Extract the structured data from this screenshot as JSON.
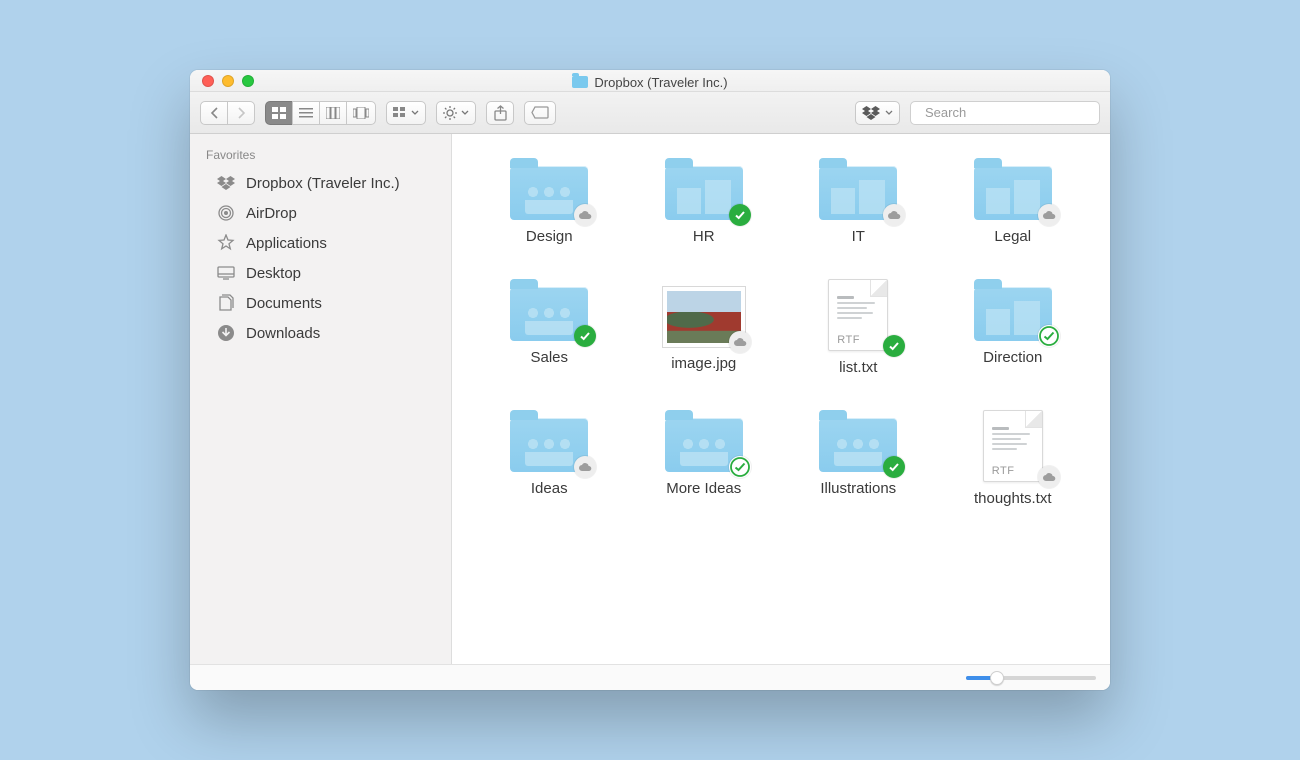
{
  "window": {
    "title": "Dropbox (Traveler Inc.)"
  },
  "search": {
    "placeholder": "Search"
  },
  "sidebar": {
    "header": "Favorites",
    "items": [
      {
        "label": "Dropbox (Traveler Inc.)",
        "icon": "dropbox"
      },
      {
        "label": "AirDrop",
        "icon": "airdrop"
      },
      {
        "label": "Applications",
        "icon": "apps"
      },
      {
        "label": "Desktop",
        "icon": "desktop"
      },
      {
        "label": "Documents",
        "icon": "documents"
      },
      {
        "label": "Downloads",
        "icon": "downloads"
      }
    ]
  },
  "items": [
    {
      "name": "Design",
      "type": "folder",
      "variant": "people",
      "badge": "cloud"
    },
    {
      "name": "HR",
      "type": "folder",
      "variant": "building",
      "badge": "sync"
    },
    {
      "name": "IT",
      "type": "folder",
      "variant": "building",
      "badge": "cloud"
    },
    {
      "name": "Legal",
      "type": "folder",
      "variant": "building",
      "badge": "cloud"
    },
    {
      "name": "Sales",
      "type": "folder",
      "variant": "people",
      "badge": "sync"
    },
    {
      "name": "image.jpg",
      "type": "image",
      "badge": "cloud"
    },
    {
      "name": "list.txt",
      "type": "doc",
      "ext": "RTF",
      "badge": "sync"
    },
    {
      "name": "Direction",
      "type": "folder",
      "variant": "building",
      "badge": "sync-outline"
    },
    {
      "name": "Ideas",
      "type": "folder",
      "variant": "people",
      "badge": "cloud"
    },
    {
      "name": "More Ideas",
      "type": "folder",
      "variant": "people",
      "badge": "sync-outline"
    },
    {
      "name": "Illustrations",
      "type": "folder",
      "variant": "people",
      "badge": "sync"
    },
    {
      "name": "thoughts.txt",
      "type": "doc",
      "ext": "RTF",
      "badge": "cloud"
    }
  ],
  "zoom": {
    "percent": 24
  },
  "colors": {
    "accent": "#3e8eea",
    "folder": "#8accee",
    "sync": "#2aad3f"
  }
}
